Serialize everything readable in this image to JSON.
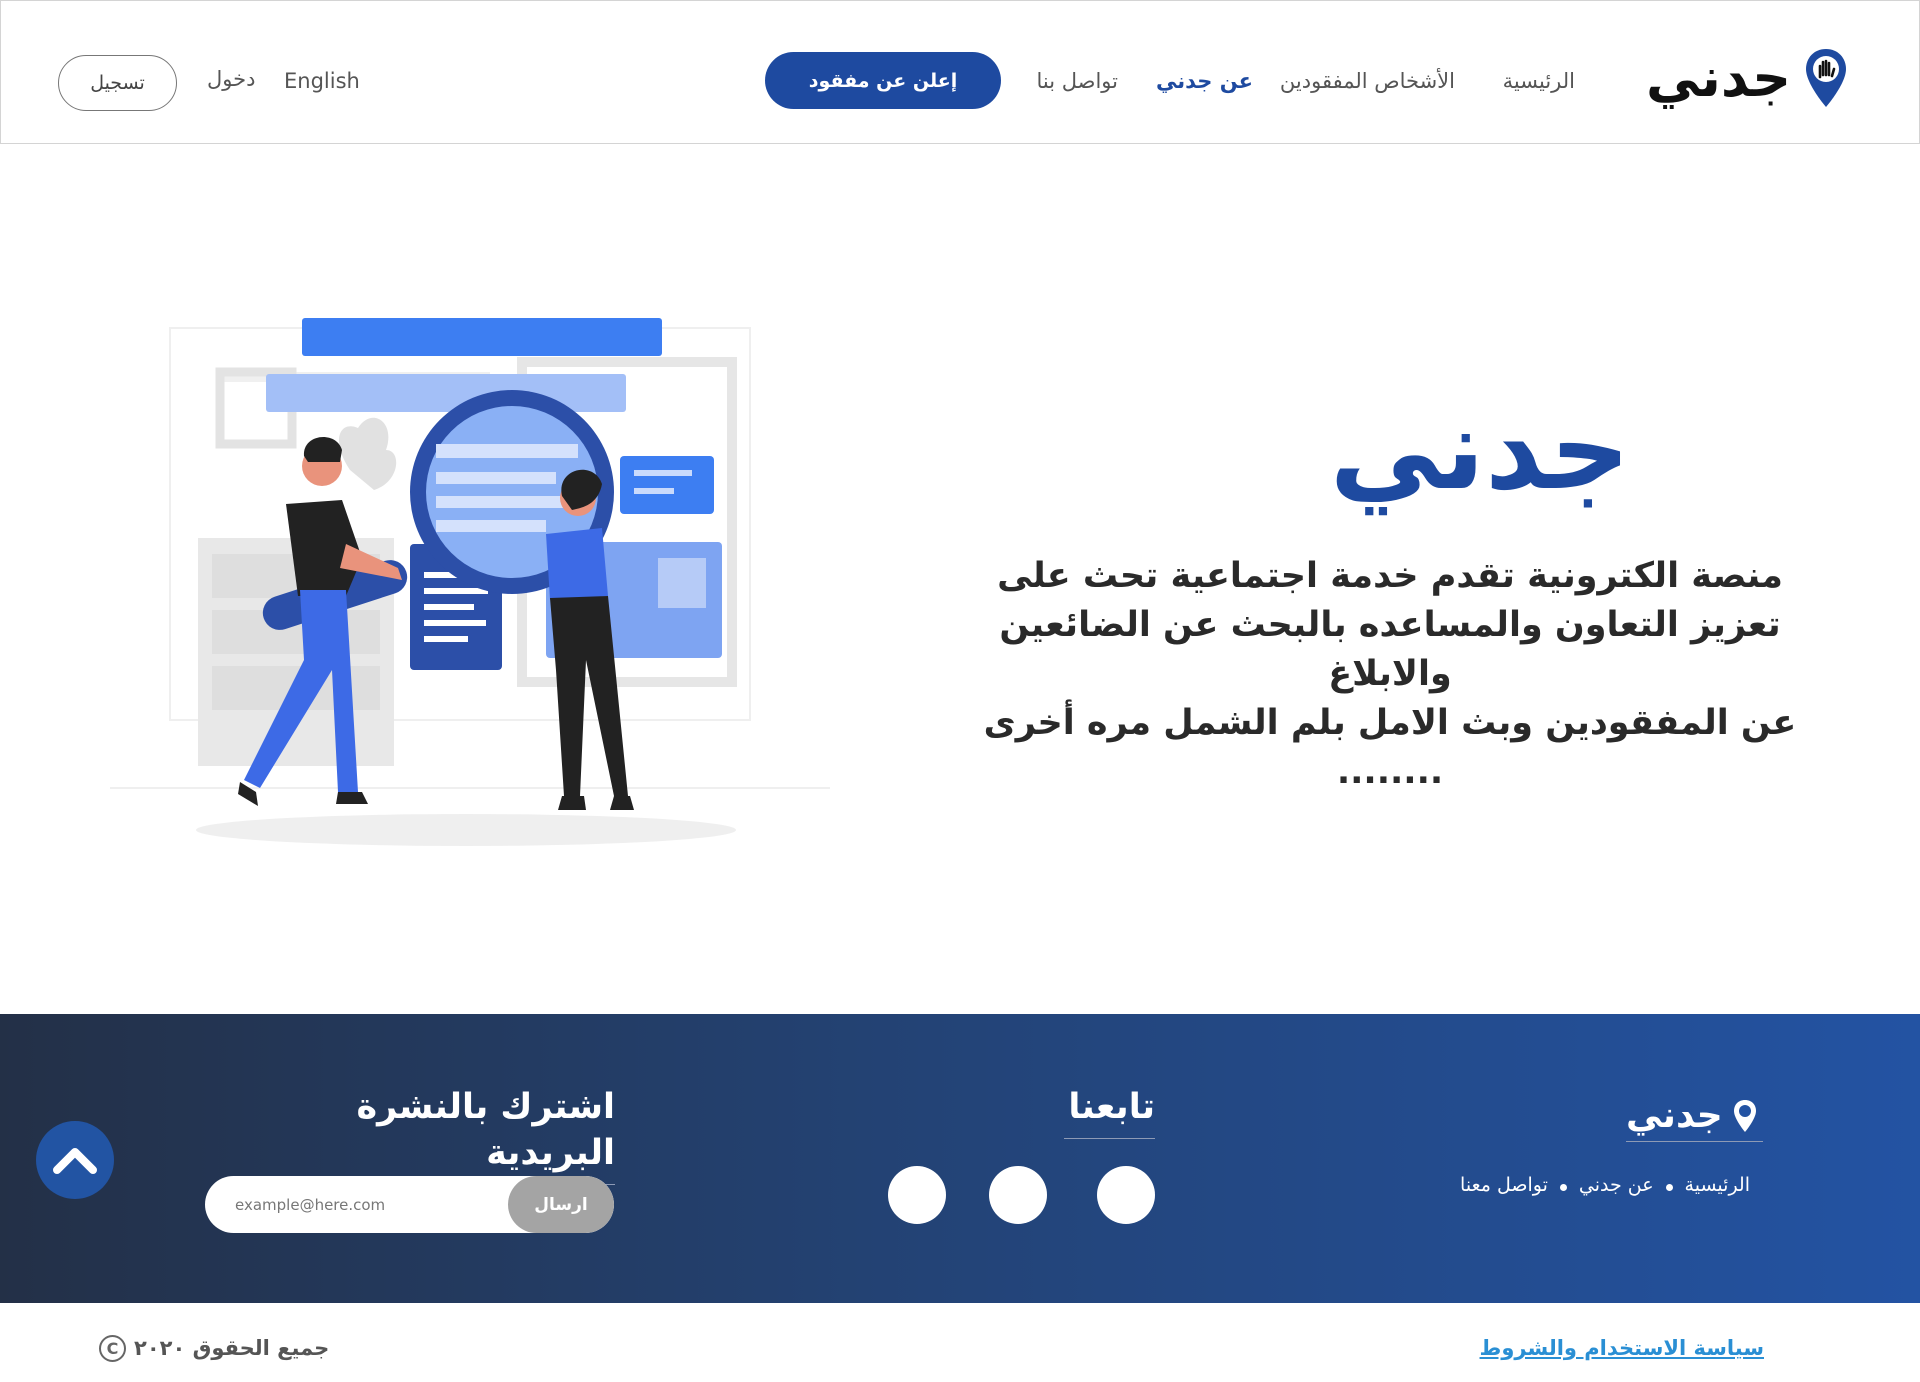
{
  "header": {
    "logo_text": "جدني",
    "nav": {
      "home": "الرئيسية",
      "missing_people": "الأشخاص المفقودين",
      "about": "عن جدني",
      "contact": "تواصل بنا"
    },
    "cta_label": "إعلن عن مفقود",
    "language": "English",
    "login": "دخول",
    "register": "تسجيل"
  },
  "hero": {
    "title": "جدني",
    "description_lines": [
      "منصة الكترونية تقدم خدمة  اجتماعية تحث على",
      "تعزيز التعاون والمساعده بالبحث عن الضائعين والابلاغ",
      "عن المفقودين  وبث الامل بلم الشمل مره أخرى",
      "........"
    ]
  },
  "footer": {
    "logo_text": "جدني",
    "links": [
      "الرئيسية",
      "عن جدني",
      "تواصل معنا"
    ],
    "follow_title": "تابعنا",
    "newsletter_title": "اشترك بالنشرة البريدية",
    "email_placeholder": "example@here.com",
    "send_label": "ارسال"
  },
  "bottom": {
    "terms": "سياسة الاستخدام والشروط",
    "copyright": "جميع الحقوق  ٢٠٢٠",
    "copyright_symbol": "C"
  },
  "colors": {
    "brand": "#1e4aa0",
    "footer_start": "#233047",
    "footer_end": "#2353a3",
    "link": "#2a8fd4"
  }
}
